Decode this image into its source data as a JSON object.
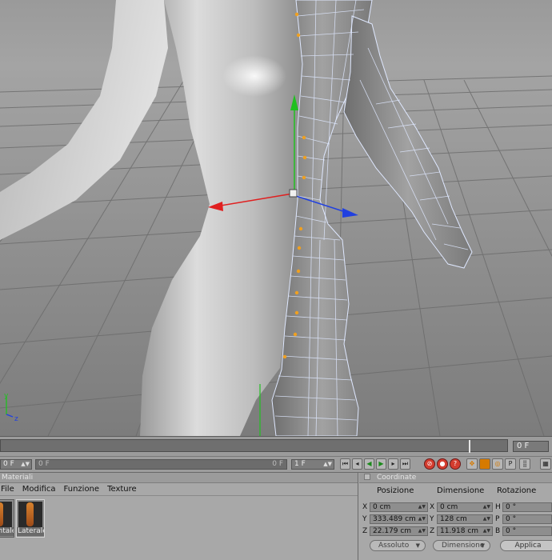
{
  "viewport": {
    "name": "perspective viewport"
  },
  "timeline": {
    "current_frame": "0 F",
    "left_label": "0"
  },
  "transport": {
    "start_field": "0 F",
    "range_start": "0 F",
    "range_end": "0 F",
    "end_field": "1 F"
  },
  "materials": {
    "title": "Materiali",
    "menu": [
      "File",
      "Modifica",
      "Funzione",
      "Texture"
    ],
    "items": [
      {
        "label": "Frontale"
      },
      {
        "label": "Laterale"
      }
    ]
  },
  "coordinates": {
    "title": "Coordinate",
    "headers": {
      "position": "Posizione",
      "dimension": "Dimensione",
      "rotation": "Rotazione"
    },
    "rows": [
      {
        "axis": "X",
        "position": "0 cm",
        "dim_axis": "X",
        "dimension": "0 cm",
        "rot_axis": "H",
        "rotation": "0 °"
      },
      {
        "axis": "Y",
        "position": "333.489 cm",
        "dim_axis": "Y",
        "dimension": "128 cm",
        "rot_axis": "P",
        "rotation": "0 °"
      },
      {
        "axis": "Z",
        "position": "22.179 cm",
        "dim_axis": "Z",
        "dimension": "11.918 cm",
        "rot_axis": "B",
        "rotation": "0 °"
      }
    ],
    "mode": "Assoluto",
    "size_mode": "Dimensione",
    "apply_label": "Applica"
  },
  "colors": {
    "x_axis": "#e02020",
    "y_axis": "#20c020",
    "z_axis": "#2040e0",
    "mesh_wire": "#dfe8ff",
    "selected_points": "#f0a020"
  }
}
